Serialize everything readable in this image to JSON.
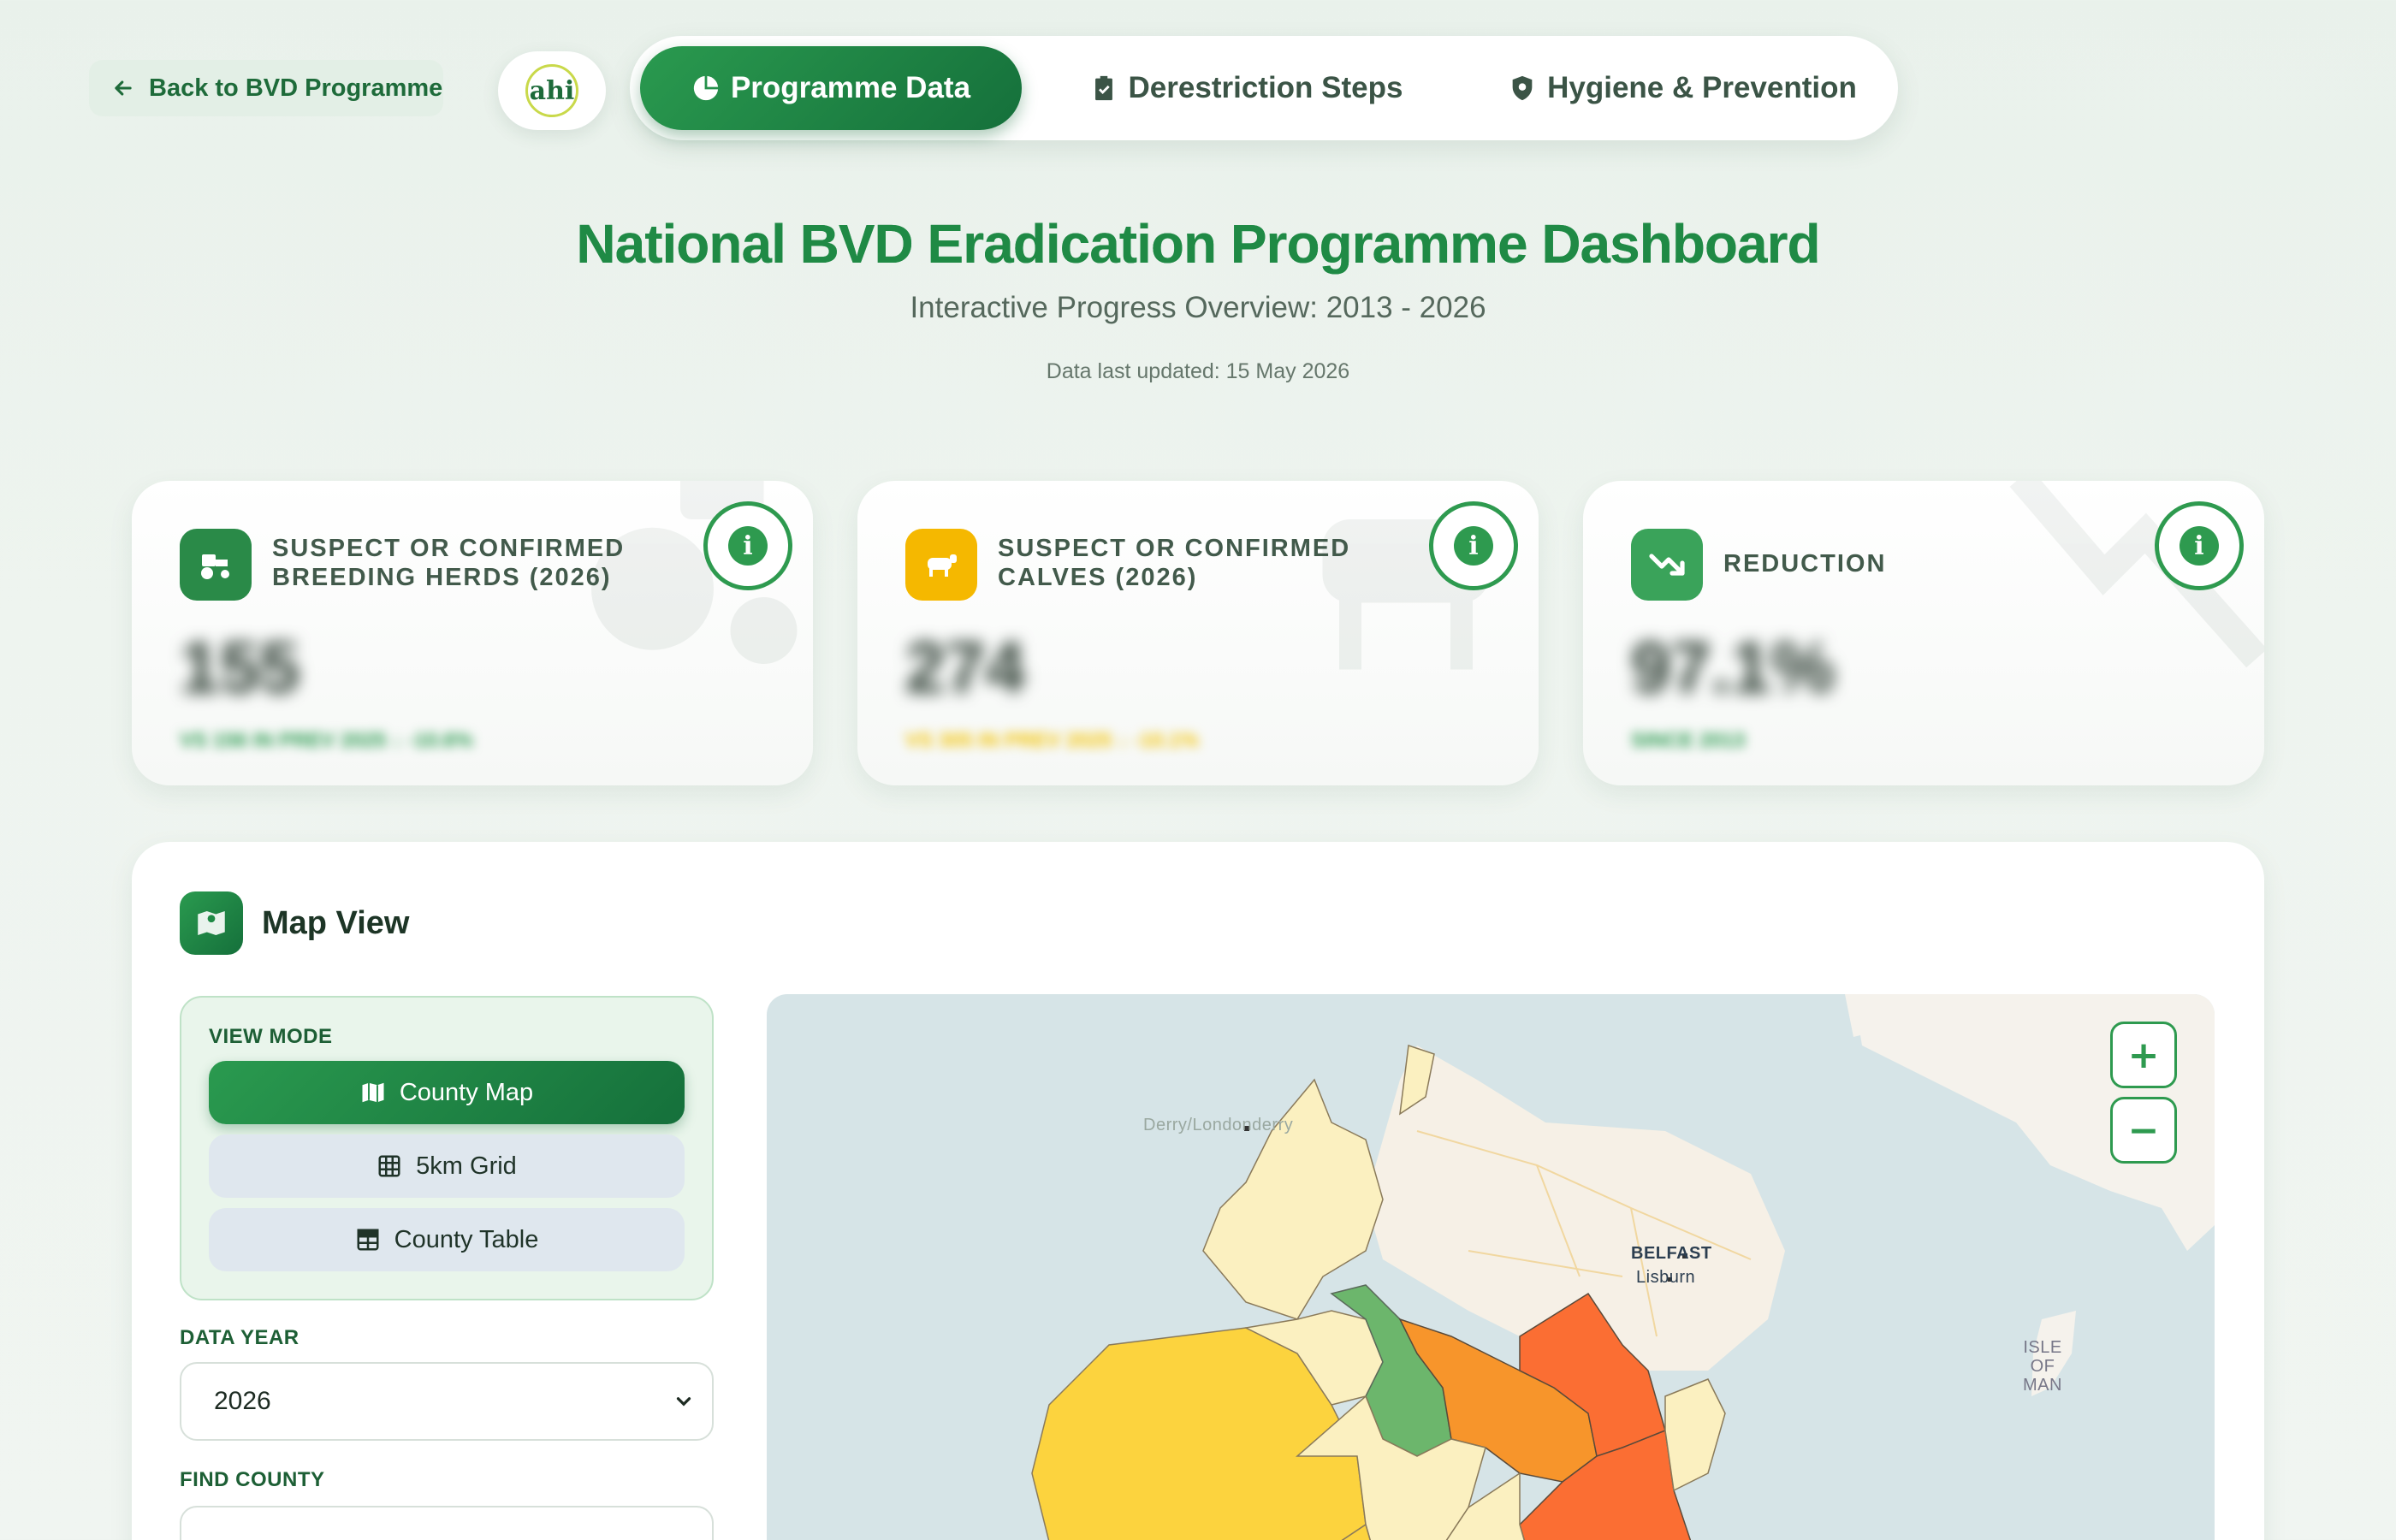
{
  "nav": {
    "back_label": "Back to BVD Programme",
    "logo_text": "ahi",
    "tabs": [
      {
        "label": "Programme Data",
        "icon": "pie-chart-icon",
        "active": true
      },
      {
        "label": "Derestriction Steps",
        "icon": "clipboard-check-icon",
        "active": false
      },
      {
        "label": "Hygiene & Prevention",
        "icon": "shield-icon",
        "active": false
      }
    ]
  },
  "header": {
    "title": "National BVD Eradication Programme Dashboard",
    "subtitle": "Interactive Progress Overview: 2013 - 2026",
    "updated": "Data last updated: 15 May 2026"
  },
  "cards": [
    {
      "label": "SUSPECT OR CONFIRMED BREEDING HERDS (2026)",
      "icon": "tractor-icon",
      "color": "#2a8a48",
      "value": "155",
      "sub": "VS 156 IN PREV 2025 ↓ -10.6%",
      "sub_color": "#2a9a4f"
    },
    {
      "label": "SUSPECT OR CONFIRMED CALVES (2026)",
      "icon": "cow-icon",
      "color": "#f5b800",
      "value": "274",
      "sub": "VS 305 IN PREV 2025 ↓ -10.1%",
      "sub_color": "#f2c200"
    },
    {
      "label": "REDUCTION",
      "icon": "trend-down-icon",
      "color": "#3aa35a",
      "value": "97.1%",
      "sub": "SINCE 2013",
      "sub_color": "#2a9a4f"
    }
  ],
  "map_panel": {
    "title": "Map View",
    "view_mode_label": "VIEW MODE",
    "view_modes": [
      {
        "label": "County Map",
        "icon": "map-icon",
        "active": true
      },
      {
        "label": "5km Grid",
        "icon": "grid-icon",
        "active": false
      },
      {
        "label": "County Table",
        "icon": "table-icon",
        "active": false
      }
    ],
    "year_label": "DATA YEAR",
    "year_value": "2026",
    "county_label": "FIND COUNTY",
    "map_labels": {
      "derry": "Derry/Londonderry",
      "belfast": "BELFAST",
      "lisburn": "Lisburn",
      "isle": "ISLE OF MAN"
    },
    "zoom_in": "+",
    "zoom_out": "−"
  }
}
